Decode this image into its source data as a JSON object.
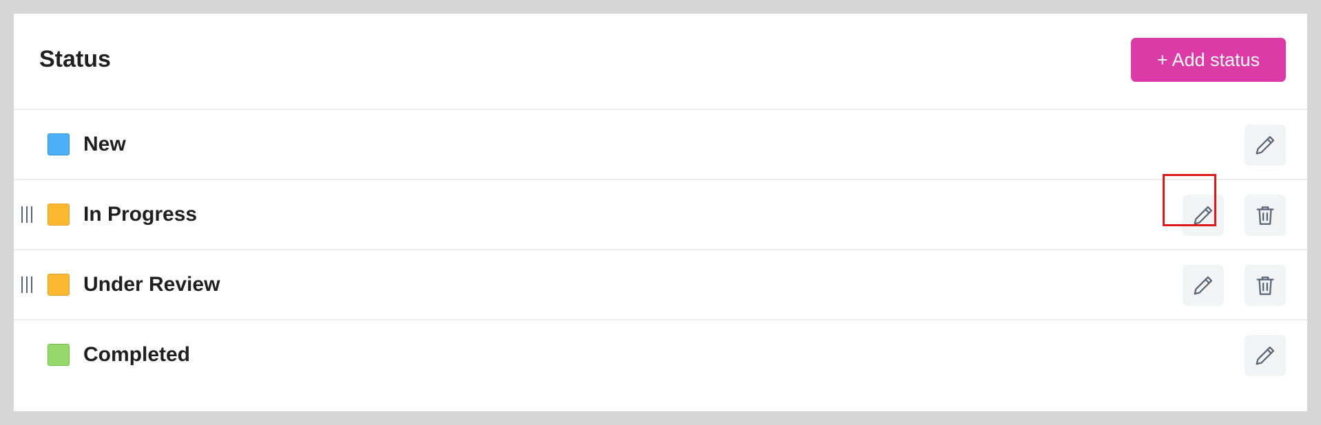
{
  "header": {
    "title": "Status",
    "add_button_label": "+ Add status",
    "add_button_color": "#dc3aa7"
  },
  "statuses": [
    {
      "label": "New",
      "color": "#4bb0f5",
      "border_color": "#2f93d8",
      "draggable": false,
      "actions": [
        "edit-icon"
      ]
    },
    {
      "label": "In Progress",
      "color": "#fdb832",
      "border_color": "#e39f1d",
      "draggable": true,
      "actions": [
        "edit-icon",
        "trash-icon"
      ]
    },
    {
      "label": "Under Review",
      "color": "#fdb832",
      "border_color": "#e39f1d",
      "draggable": true,
      "actions": [
        "edit-icon",
        "trash-icon"
      ]
    },
    {
      "label": "Completed",
      "color": "#96d96b",
      "border_color": "#72bc48",
      "draggable": false,
      "actions": [
        "edit-icon"
      ]
    }
  ],
  "highlighted_element": "In Progress edit button"
}
